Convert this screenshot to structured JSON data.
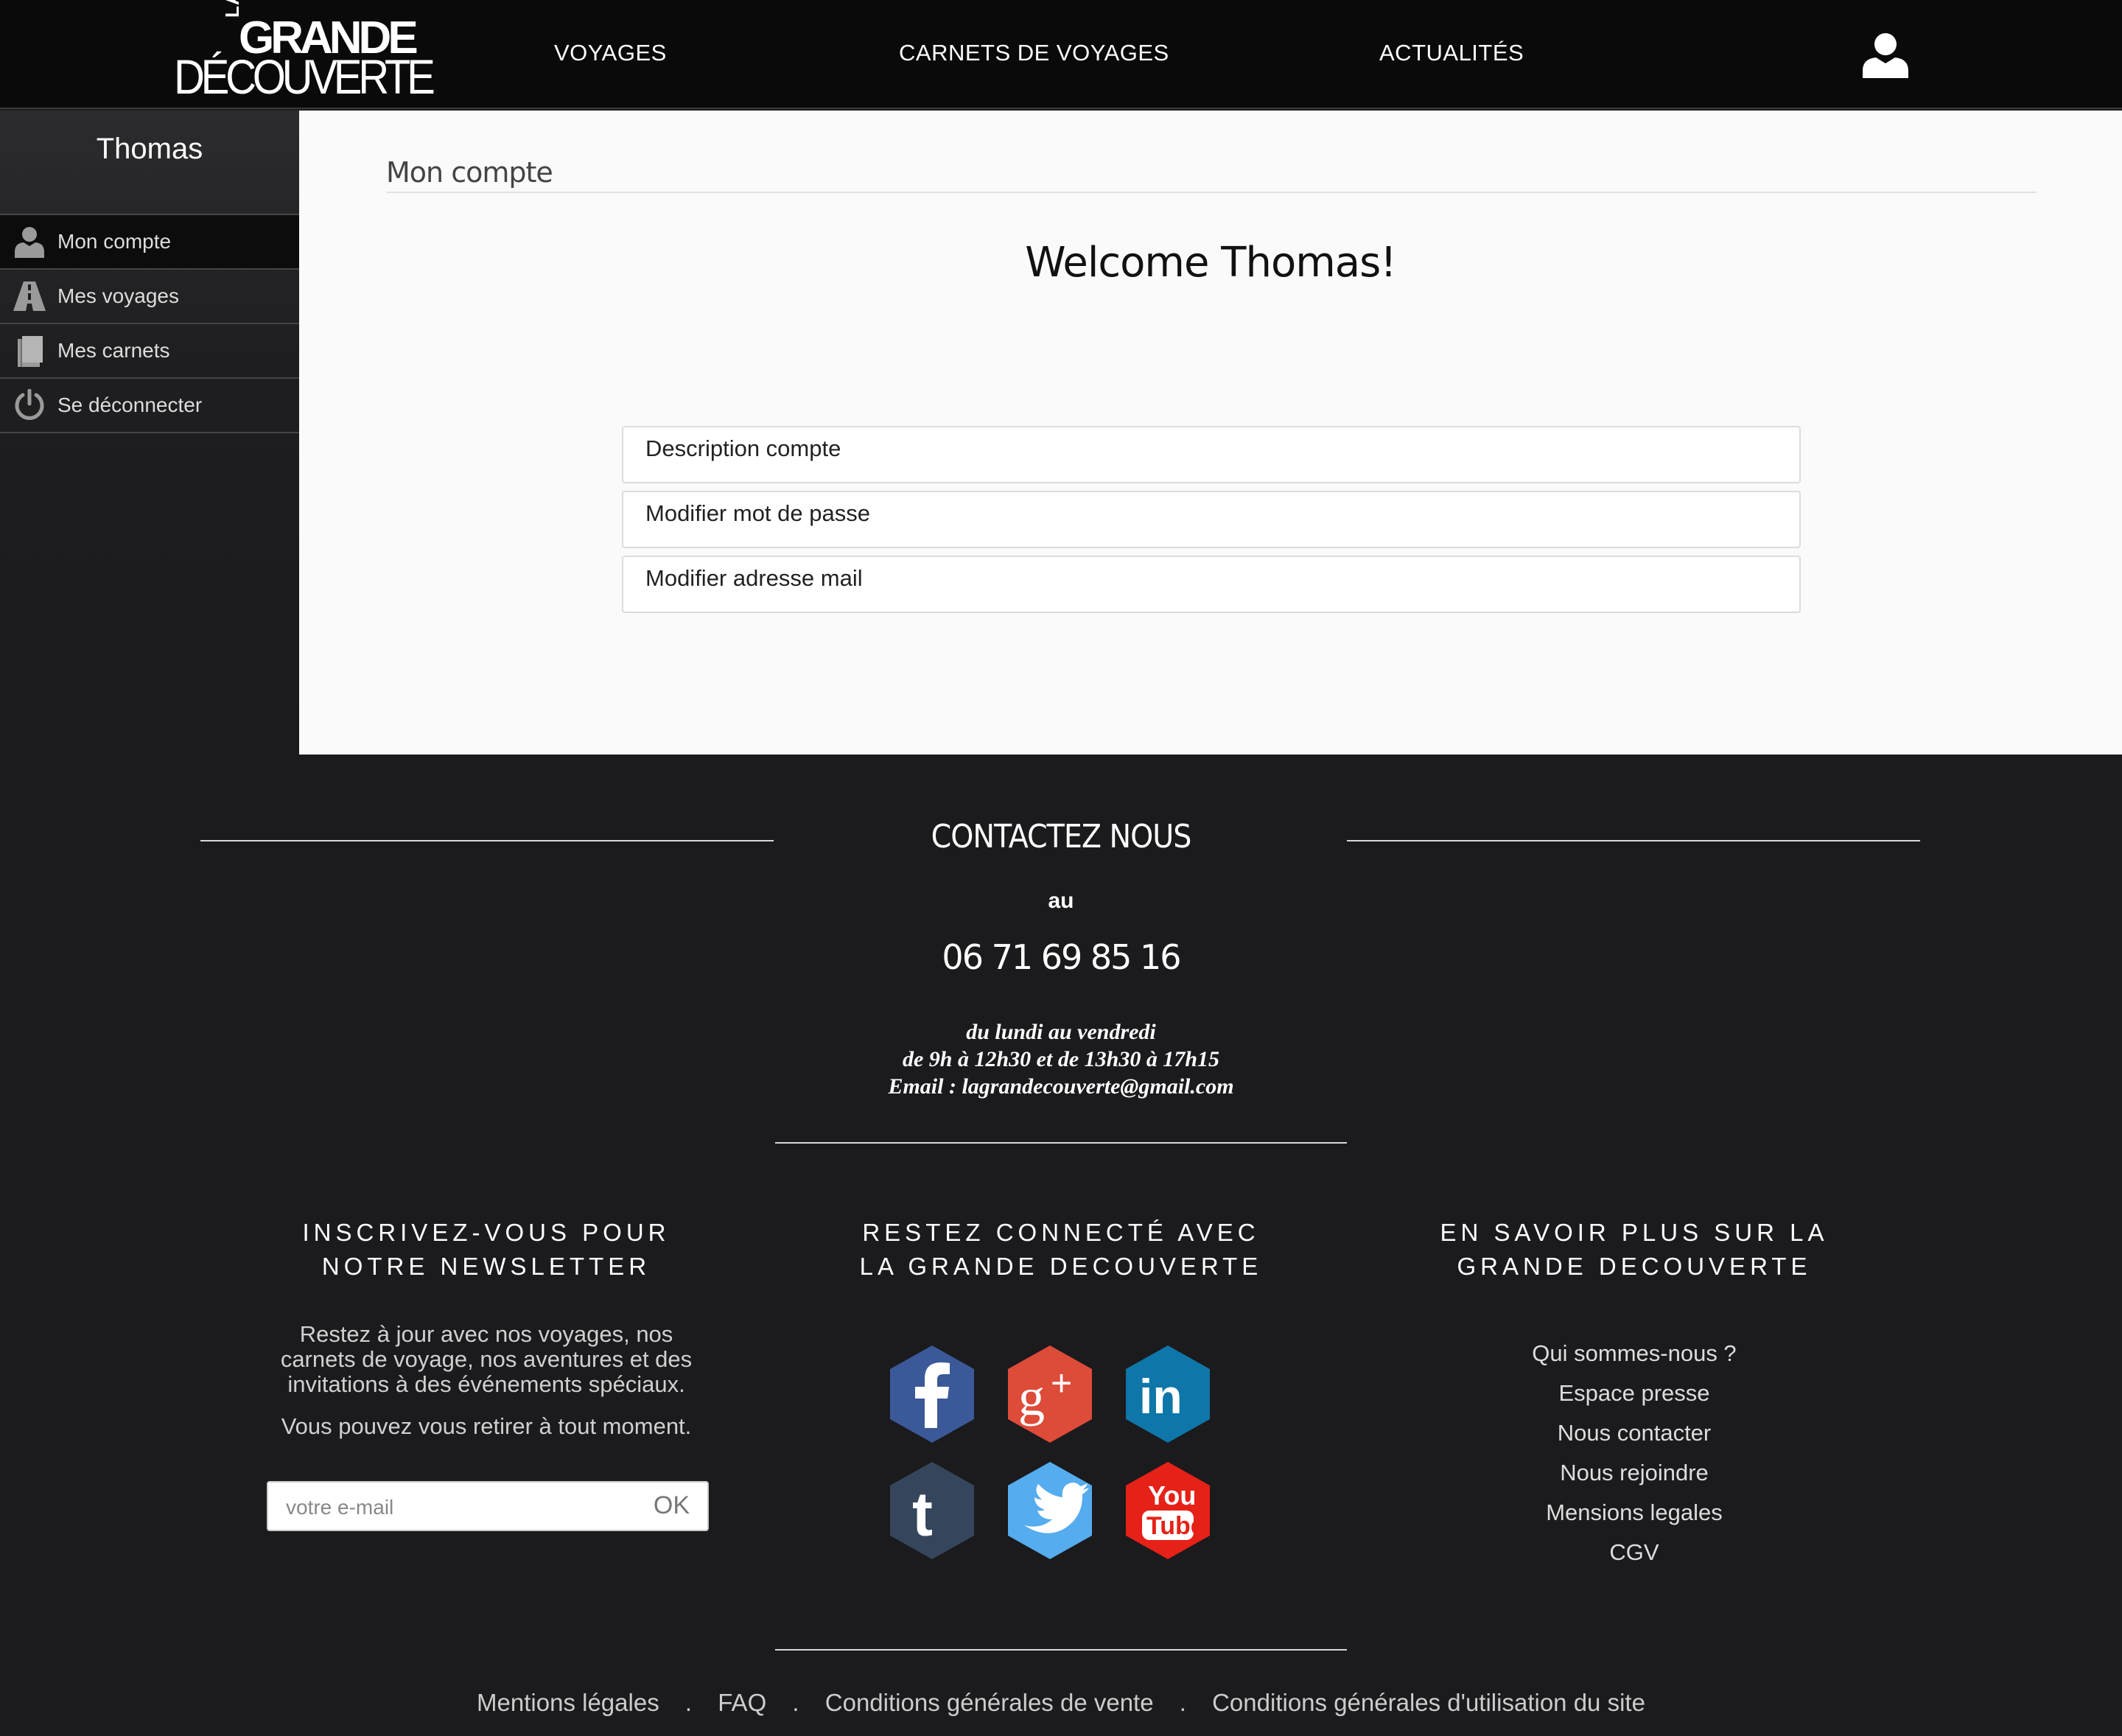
{
  "header": {
    "logo": {
      "la": "LA",
      "grande": "GRANDE",
      "decouverte": "DÉCOUVERTE"
    },
    "nav": [
      "VOYAGES",
      "CARNETS DE VOYAGES",
      "ACTUALITÉS"
    ],
    "user_icon": "user-icon"
  },
  "sidebar": {
    "username": "Thomas",
    "items": [
      {
        "label": "Mon compte",
        "icon": "user-icon",
        "active": true
      },
      {
        "label": "Mes voyages",
        "icon": "road-icon",
        "active": false
      },
      {
        "label": "Mes carnets",
        "icon": "book-icon",
        "active": false
      },
      {
        "label": "Se déconnecter",
        "icon": "power-icon",
        "active": false
      }
    ]
  },
  "main": {
    "breadcrumb": "Mon compte",
    "welcome": "Welcome Thomas!",
    "panels": [
      "Description compte",
      "Modifier mot de passe",
      "Modifier adresse mail"
    ]
  },
  "footer": {
    "contact": {
      "title": "CONTACTEZ NOUS",
      "au": "au",
      "phone": "06 71 69 85 16",
      "hours_line1": "du lundi au vendredi",
      "hours_line2": "de 9h à 12h30 et de 13h30 à 17h15",
      "email_line": "Email : lagrandecouverte@gmail.com"
    },
    "newsletter": {
      "title": "INSCRIVEZ-VOUS POUR NOTRE NEWSLETTER",
      "text": "Restez à jour avec nos voyages, nos carnets de voyage, nos aventures et des invitations à des événements spéciaux.",
      "text2": "Vous pouvez vous retirer à tout moment.",
      "placeholder": "votre e-mail",
      "button": "OK"
    },
    "social": {
      "title": "RESTEZ CONNECTÉ AVEC LA GRANDE DECOUVERTE",
      "networks": [
        {
          "name": "facebook-icon",
          "color": "#3b5998"
        },
        {
          "name": "google-plus-icon",
          "color": "#dd4b39"
        },
        {
          "name": "linkedin-icon",
          "color": "#0e76a8"
        },
        {
          "name": "tumblr-icon",
          "color": "#35465c"
        },
        {
          "name": "twitter-icon",
          "color": "#55acee"
        },
        {
          "name": "youtube-icon",
          "color": "#e62117"
        }
      ]
    },
    "about": {
      "title": "EN SAVOIR PLUS SUR LA GRANDE DECOUVERTE",
      "links": [
        "Qui sommes-nous ?",
        "Espace presse",
        "Nous contacter",
        "Nous rejoindre",
        "Mensions legales",
        "CGV"
      ]
    },
    "bottom_links": [
      "Mentions légales",
      "FAQ",
      "Conditions générales de vente",
      "Conditions générales d'utilisation du site"
    ],
    "separator": "."
  }
}
